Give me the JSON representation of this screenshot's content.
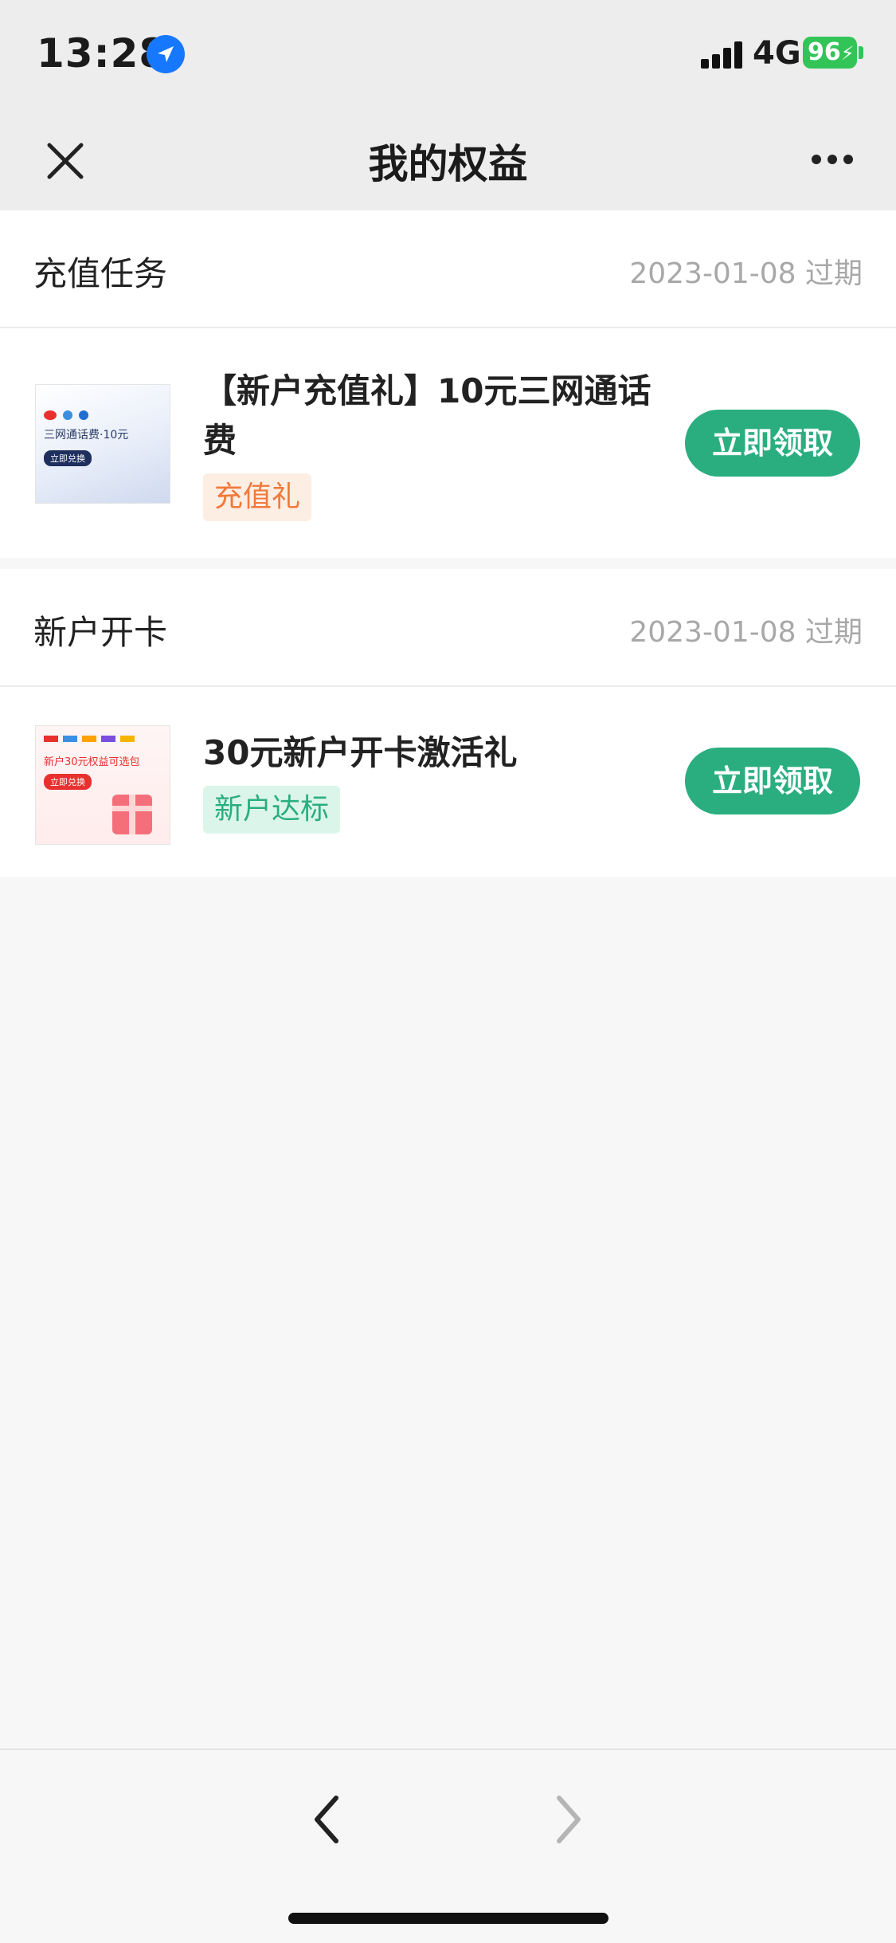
{
  "status": {
    "time": "13:28",
    "network": "4G",
    "battery": "96"
  },
  "nav": {
    "title": "我的权益"
  },
  "sections": [
    {
      "title": "充值任务",
      "date": "2023-01-08 过期",
      "item": {
        "title": "【新户充值礼】10元三网通话费",
        "tag": "充值礼",
        "button": "立即领取",
        "thumb": {
          "text": "三网通话费·10元",
          "button": "立即兑换"
        }
      }
    },
    {
      "title": "新户开卡",
      "date": "2023-01-08 过期",
      "item": {
        "title": "30元新户开卡激活礼",
        "tag": "新户达标",
        "button": "立即领取",
        "thumb": {
          "text": "新户30元权益可选包",
          "button": "立即兑换"
        }
      }
    }
  ],
  "colors": {
    "accent": "#2aae80",
    "tag_orange_text": "#f0793a",
    "tag_orange_bg": "#fdeee4",
    "tag_green_text": "#2aae80",
    "tag_green_bg": "#dcf5ea"
  }
}
